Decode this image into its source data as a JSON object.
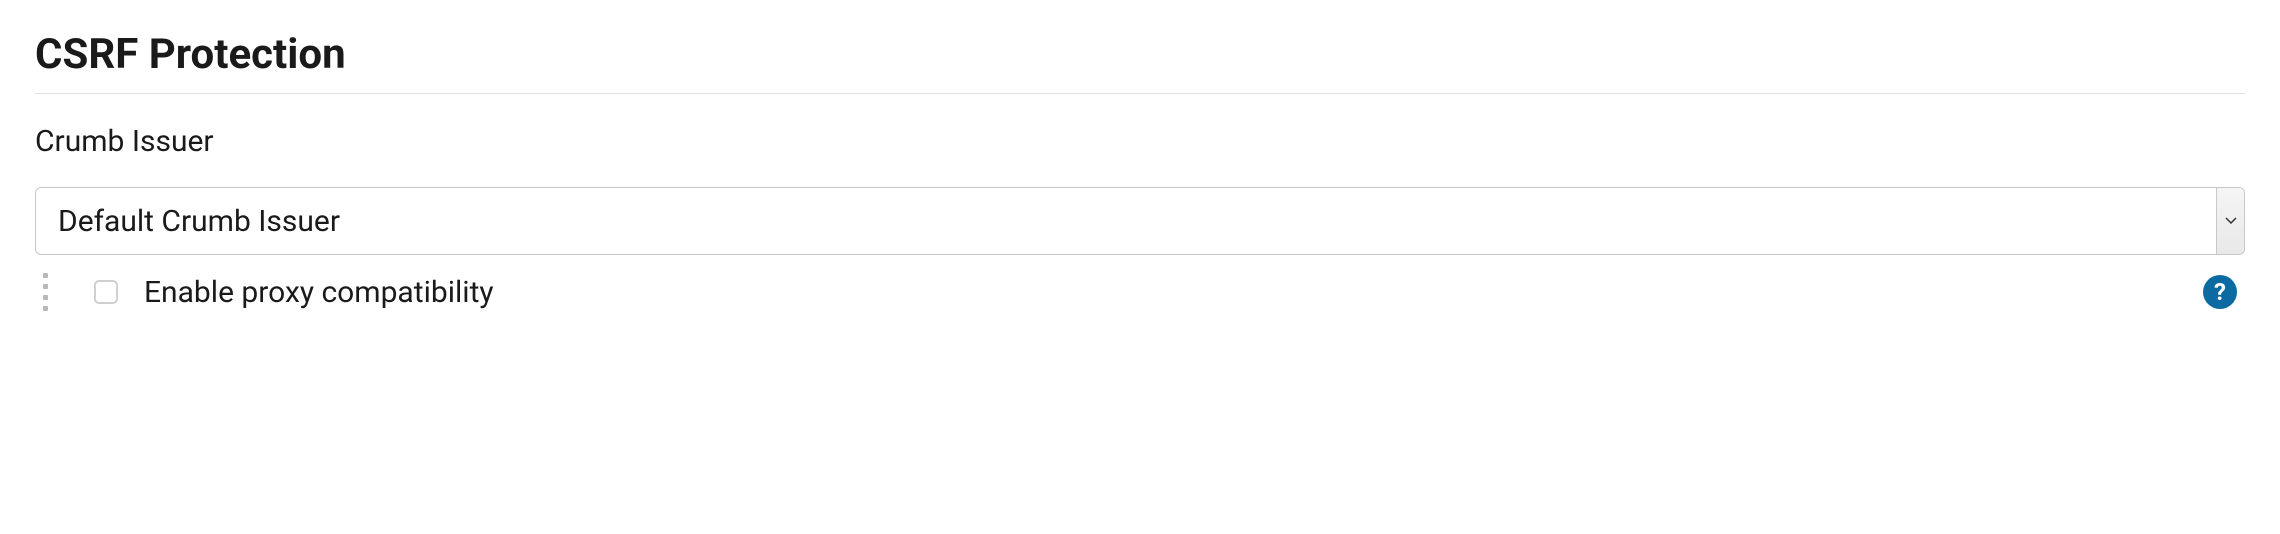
{
  "section": {
    "title": "CSRF Protection"
  },
  "crumbIssuer": {
    "label": "Crumb Issuer",
    "selected": "Default Crumb Issuer",
    "option": {
      "checkboxLabel": "Enable proxy compatibility",
      "checked": false
    }
  },
  "help": {
    "symbol": "?"
  }
}
